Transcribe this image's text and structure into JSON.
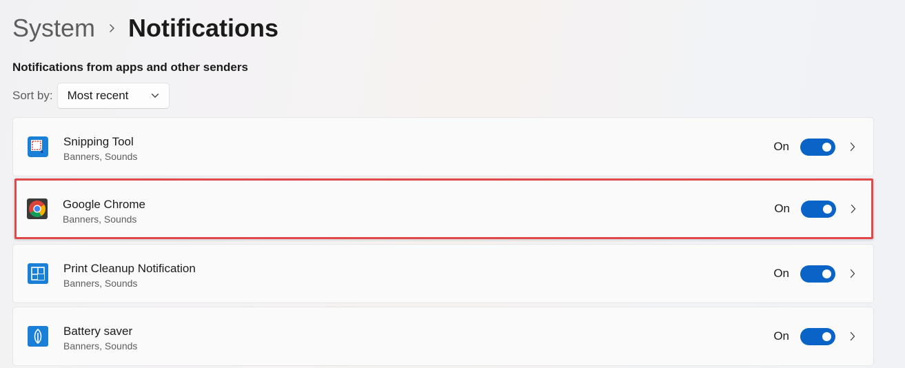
{
  "breadcrumb": {
    "parent": "System",
    "current": "Notifications"
  },
  "section": {
    "heading": "Notifications from apps and other senders"
  },
  "sort": {
    "label": "Sort by:",
    "value": "Most recent"
  },
  "apps": [
    {
      "name": "Snipping Tool",
      "details": "Banners, Sounds",
      "state": "On",
      "enabled": true,
      "icon": "snipping-tool-icon"
    },
    {
      "name": "Google Chrome",
      "details": "Banners, Sounds",
      "state": "On",
      "enabled": true,
      "icon": "chrome-icon"
    },
    {
      "name": "Print Cleanup Notification",
      "details": "Banners, Sounds",
      "state": "On",
      "enabled": true,
      "icon": "print-cleanup-icon"
    },
    {
      "name": "Battery saver",
      "details": "Banners, Sounds",
      "state": "On",
      "enabled": true,
      "icon": "battery-saver-icon"
    }
  ],
  "colors": {
    "accent": "#0a64c8",
    "highlight": "#e04849"
  }
}
